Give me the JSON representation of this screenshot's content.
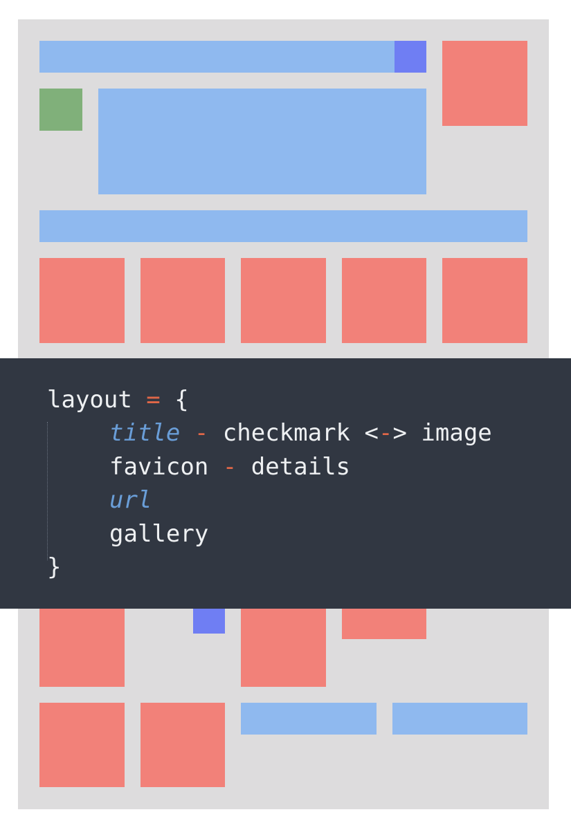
{
  "colors": {
    "panel": "#dddcdd",
    "blue": "#8fb9ef",
    "red": "#f28179",
    "green": "#80b07a",
    "indigo": "#6f7ef3",
    "code_bg": "#313742",
    "code_text": "#eef0f2",
    "code_operator": "#e06748",
    "code_italic": "#6a9ed8"
  },
  "code": {
    "line1": {
      "ident": "layout",
      "op": " = ",
      "brace": "{"
    },
    "line2": {
      "item1": "title",
      "op1": " - ",
      "item2": "checkmark",
      "op2a": " <",
      "op2b": "-",
      "op2c": "> ",
      "item3": "image"
    },
    "line3": {
      "item1": "favicon",
      "op1": " - ",
      "item2": "details"
    },
    "line4": {
      "item1": "url"
    },
    "line5": {
      "item1": "gallery"
    },
    "line6": {
      "brace": "}"
    }
  }
}
